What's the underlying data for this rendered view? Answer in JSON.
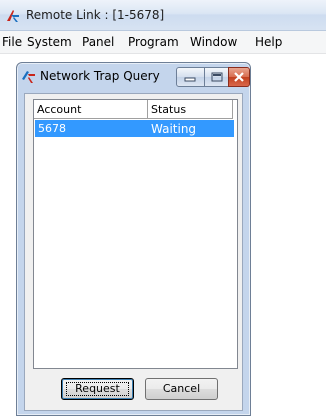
{
  "app": {
    "title": "Remote Link : [1-5678]",
    "menu": [
      "File",
      "System",
      "Panel",
      "Program",
      "Window",
      "Help"
    ],
    "logo_icon": "remote-link-logo-icon"
  },
  "dialog": {
    "title": "Network Trap Query",
    "buttons": {
      "minimize": "minimize-icon",
      "maximize": "maximize-icon",
      "close": "close-icon"
    },
    "list": {
      "columns": [
        "Account",
        "Status"
      ],
      "rows": [
        {
          "account": "5678",
          "status": "Waiting",
          "selected": true
        }
      ]
    },
    "request_label": "Request",
    "cancel_label": "Cancel"
  },
  "colors": {
    "selection": "#3399ff",
    "close_button": "#c2401f",
    "dialog_frame": "#c4d5ec"
  }
}
